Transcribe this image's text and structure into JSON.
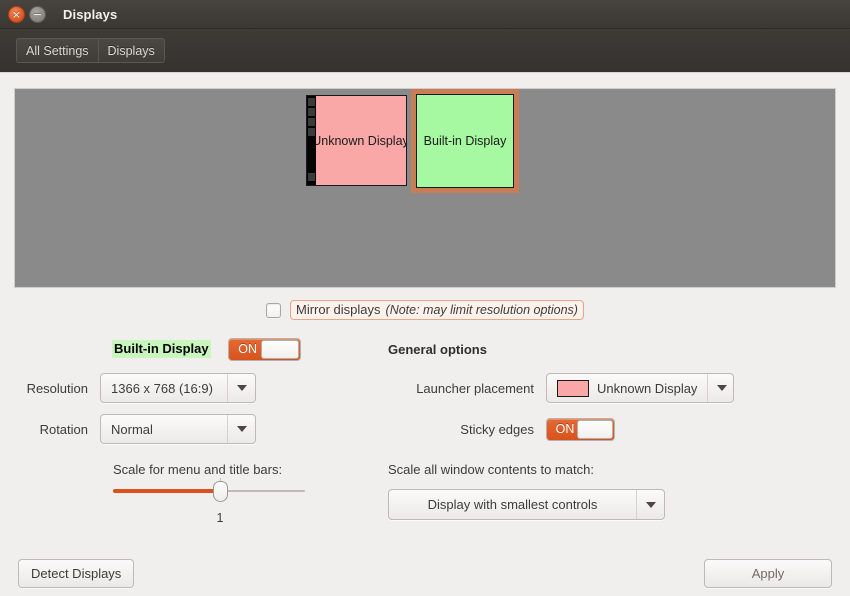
{
  "window": {
    "title": "Displays",
    "close_icon": "close-icon",
    "minimize_icon": "minimize-icon",
    "close_glyph": "×",
    "minimize_glyph": "−",
    "close_color": "#e25c28",
    "minimize_color": "#8d8984"
  },
  "toolbar": {
    "all_settings_label": "All Settings",
    "displays_label": "Displays"
  },
  "preview": {
    "background_color": "#8a8a8a",
    "monitors": [
      {
        "label": "Unknown Display",
        "color": "#f9a7a7",
        "selected": false,
        "has_launcher": true,
        "launcher_icon_count": 5
      },
      {
        "label": "Built-in Display",
        "color": "#a6f9a0",
        "selected": true,
        "selection_color": "#c87d56",
        "has_launcher": false
      }
    ]
  },
  "mirror": {
    "checked": false,
    "label": "Mirror displays",
    "note": "(Note: may limit resolution options)",
    "focus_outline_color": "#eaa584"
  },
  "display_settings": {
    "name": "Built-in Display",
    "name_highlight_color": "#c9f6bd",
    "power_toggle": {
      "state_label": "ON",
      "on": true,
      "accent_color": "#d9521d"
    },
    "resolution_label": "Resolution",
    "resolution_value": "1366 x 768 (16:9)",
    "rotation_label": "Rotation",
    "rotation_value": "Normal",
    "scale_caption": "Scale for menu and title bars:",
    "scale_value": "1",
    "scale_fill_color": "#d9521d"
  },
  "general_options": {
    "heading": "General options",
    "launcher_placement_label": "Launcher placement",
    "launcher_placement_value": "Unknown Display",
    "launcher_placement_swatch_color": "#f9a7a7",
    "sticky_edges_label": "Sticky edges",
    "sticky_edges_toggle": {
      "state_label": "ON",
      "on": true,
      "accent_color": "#d9521d"
    },
    "scale_all_caption": "Scale all window contents to match:",
    "scale_all_value": "Display with smallest controls"
  },
  "footer": {
    "detect_label": "Detect Displays",
    "apply_label": "Apply"
  }
}
